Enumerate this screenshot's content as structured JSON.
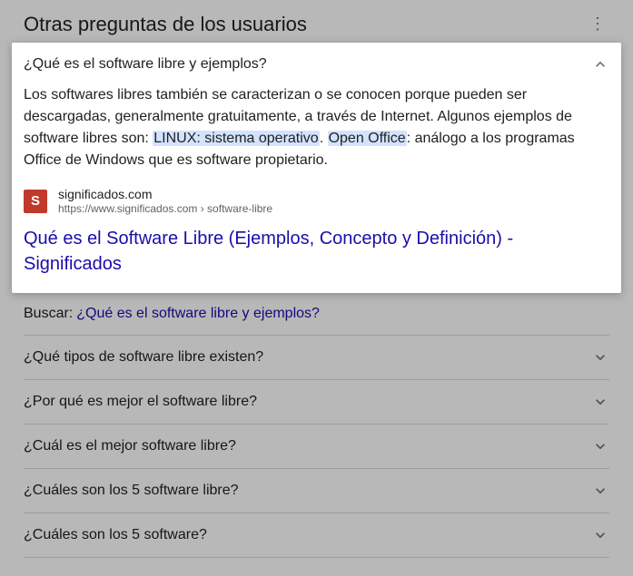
{
  "section_title": "Otras preguntas de los usuarios",
  "expanded": {
    "question": "¿Qué es el software libre y ejemplos?",
    "answer_pre": "Los softwares libres también se caracterizan o se conocen porque pueden ser descargadas, generalmente gratuitamente, a través de Internet. Algunos ejemplos de software libres son: ",
    "highlight1": "LINUX: sistema operativo",
    "answer_mid": ". ",
    "highlight2": "Open Office",
    "answer_post": ": análogo a los programas Office de Windows que es software propietario.",
    "favicon_letter": "S",
    "source_domain": "significados.com",
    "source_url": "https://www.significados.com › software-libre",
    "result_title": "Qué es el Software Libre (Ejemplos, Concepto y Definición) - Significados"
  },
  "search_for": {
    "label": "Buscar:",
    "link": "¿Qué es el software libre y ejemplos?"
  },
  "questions": [
    "¿Qué tipos de software libre existen?",
    "¿Por qué es mejor el software libre?",
    "¿Cuál es el mejor software libre?",
    "¿Cuáles son los 5 software libre?",
    "¿Cuáles son los 5 software?"
  ]
}
